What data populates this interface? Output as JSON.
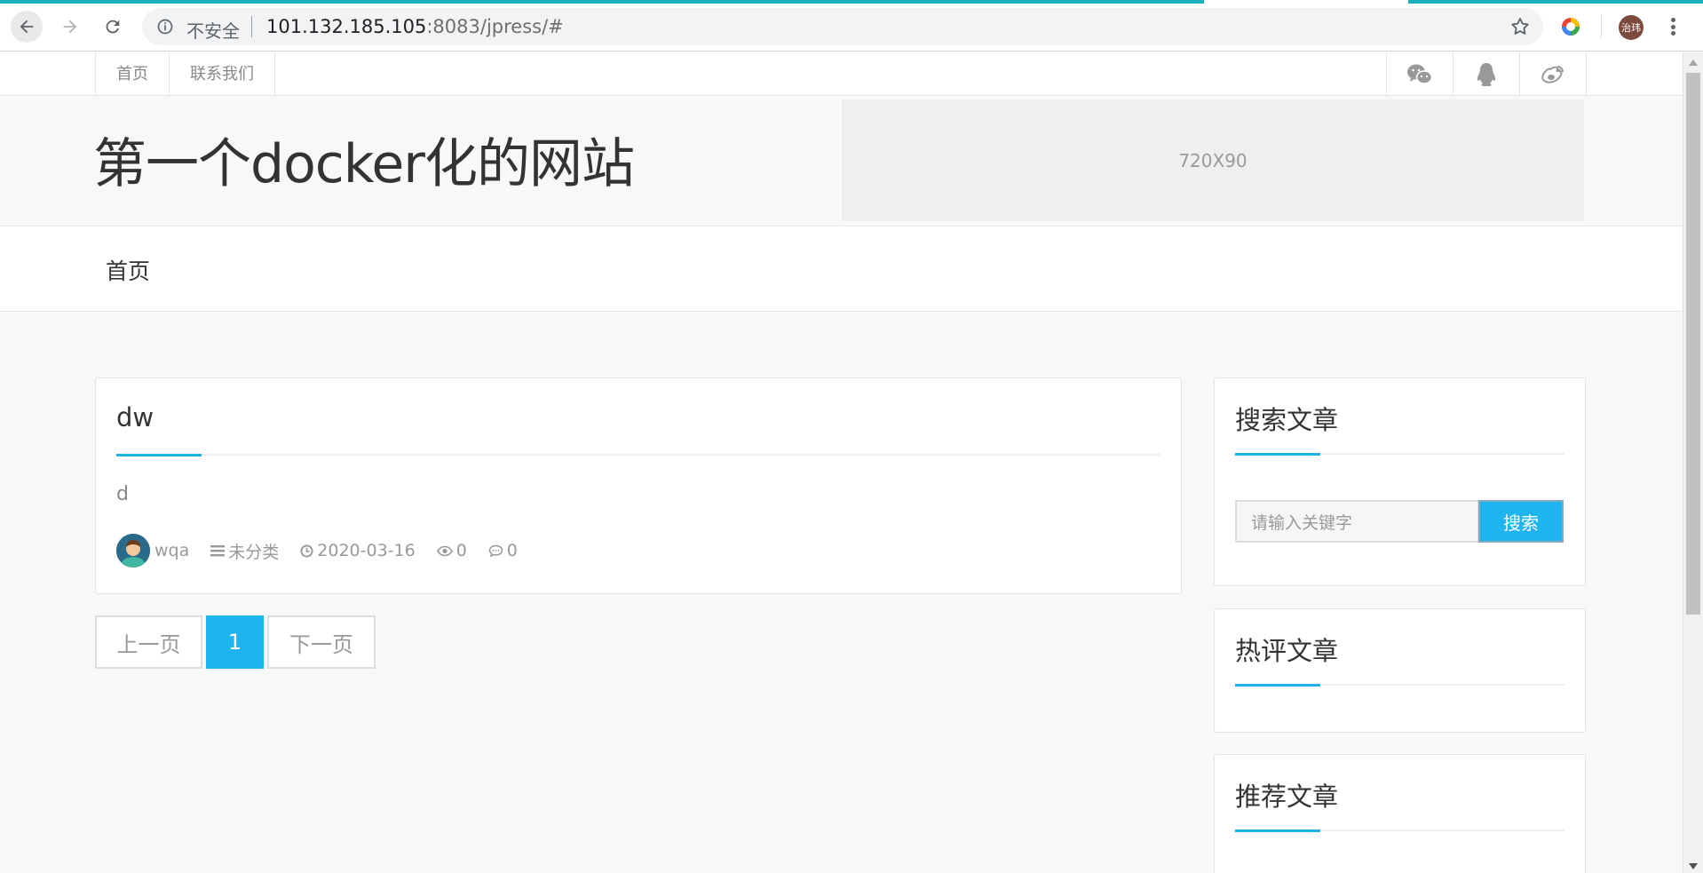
{
  "browser": {
    "security_label": "不安全",
    "url_host": "101.132.185.105",
    "url_rest": ":8083/jpress/#",
    "profile_initials": "治玮",
    "accent_color": "#18b0bd"
  },
  "topbar": {
    "links": [
      "首页",
      "联系我们"
    ],
    "social_icons": [
      "wechat-icon",
      "qq-icon",
      "weibo-icon"
    ]
  },
  "header": {
    "site_title": "第一个docker化的网站",
    "ad_label": "720X90"
  },
  "main_nav": {
    "items": [
      "首页"
    ]
  },
  "post": {
    "title": "dw",
    "excerpt": "d",
    "author": "wqa",
    "category": "未分类",
    "date": "2020-03-16",
    "views": "0",
    "comments": "0"
  },
  "pagination": {
    "prev": "上一页",
    "current": "1",
    "next": "下一页"
  },
  "sidebar": {
    "search": {
      "title": "搜索文章",
      "placeholder": "请输入关键字",
      "button": "搜索"
    },
    "hot": {
      "title": "热评文章"
    },
    "recommended": {
      "title": "推荐文章"
    }
  },
  "colors": {
    "accent": "#1eb4f0",
    "text": "#333333",
    "muted": "#999999"
  }
}
